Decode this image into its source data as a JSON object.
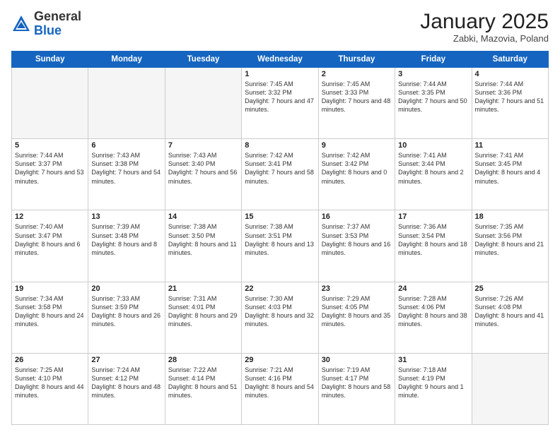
{
  "logo": {
    "general": "General",
    "blue": "Blue"
  },
  "header": {
    "month": "January 2025",
    "location": "Zabki, Mazovia, Poland"
  },
  "days": [
    "Sunday",
    "Monday",
    "Tuesday",
    "Wednesday",
    "Thursday",
    "Friday",
    "Saturday"
  ],
  "weeks": [
    [
      {
        "day": "",
        "content": ""
      },
      {
        "day": "",
        "content": ""
      },
      {
        "day": "",
        "content": ""
      },
      {
        "day": "1",
        "content": "Sunrise: 7:45 AM\nSunset: 3:32 PM\nDaylight: 7 hours and 47 minutes."
      },
      {
        "day": "2",
        "content": "Sunrise: 7:45 AM\nSunset: 3:33 PM\nDaylight: 7 hours and 48 minutes."
      },
      {
        "day": "3",
        "content": "Sunrise: 7:44 AM\nSunset: 3:35 PM\nDaylight: 7 hours and 50 minutes."
      },
      {
        "day": "4",
        "content": "Sunrise: 7:44 AM\nSunset: 3:36 PM\nDaylight: 7 hours and 51 minutes."
      }
    ],
    [
      {
        "day": "5",
        "content": "Sunrise: 7:44 AM\nSunset: 3:37 PM\nDaylight: 7 hours and 53 minutes."
      },
      {
        "day": "6",
        "content": "Sunrise: 7:43 AM\nSunset: 3:38 PM\nDaylight: 7 hours and 54 minutes."
      },
      {
        "day": "7",
        "content": "Sunrise: 7:43 AM\nSunset: 3:40 PM\nDaylight: 7 hours and 56 minutes."
      },
      {
        "day": "8",
        "content": "Sunrise: 7:42 AM\nSunset: 3:41 PM\nDaylight: 7 hours and 58 minutes."
      },
      {
        "day": "9",
        "content": "Sunrise: 7:42 AM\nSunset: 3:42 PM\nDaylight: 8 hours and 0 minutes."
      },
      {
        "day": "10",
        "content": "Sunrise: 7:41 AM\nSunset: 3:44 PM\nDaylight: 8 hours and 2 minutes."
      },
      {
        "day": "11",
        "content": "Sunrise: 7:41 AM\nSunset: 3:45 PM\nDaylight: 8 hours and 4 minutes."
      }
    ],
    [
      {
        "day": "12",
        "content": "Sunrise: 7:40 AM\nSunset: 3:47 PM\nDaylight: 8 hours and 6 minutes."
      },
      {
        "day": "13",
        "content": "Sunrise: 7:39 AM\nSunset: 3:48 PM\nDaylight: 8 hours and 8 minutes."
      },
      {
        "day": "14",
        "content": "Sunrise: 7:38 AM\nSunset: 3:50 PM\nDaylight: 8 hours and 11 minutes."
      },
      {
        "day": "15",
        "content": "Sunrise: 7:38 AM\nSunset: 3:51 PM\nDaylight: 8 hours and 13 minutes."
      },
      {
        "day": "16",
        "content": "Sunrise: 7:37 AM\nSunset: 3:53 PM\nDaylight: 8 hours and 16 minutes."
      },
      {
        "day": "17",
        "content": "Sunrise: 7:36 AM\nSunset: 3:54 PM\nDaylight: 8 hours and 18 minutes."
      },
      {
        "day": "18",
        "content": "Sunrise: 7:35 AM\nSunset: 3:56 PM\nDaylight: 8 hours and 21 minutes."
      }
    ],
    [
      {
        "day": "19",
        "content": "Sunrise: 7:34 AM\nSunset: 3:58 PM\nDaylight: 8 hours and 24 minutes."
      },
      {
        "day": "20",
        "content": "Sunrise: 7:33 AM\nSunset: 3:59 PM\nDaylight: 8 hours and 26 minutes."
      },
      {
        "day": "21",
        "content": "Sunrise: 7:31 AM\nSunset: 4:01 PM\nDaylight: 8 hours and 29 minutes."
      },
      {
        "day": "22",
        "content": "Sunrise: 7:30 AM\nSunset: 4:03 PM\nDaylight: 8 hours and 32 minutes."
      },
      {
        "day": "23",
        "content": "Sunrise: 7:29 AM\nSunset: 4:05 PM\nDaylight: 8 hours and 35 minutes."
      },
      {
        "day": "24",
        "content": "Sunrise: 7:28 AM\nSunset: 4:06 PM\nDaylight: 8 hours and 38 minutes."
      },
      {
        "day": "25",
        "content": "Sunrise: 7:26 AM\nSunset: 4:08 PM\nDaylight: 8 hours and 41 minutes."
      }
    ],
    [
      {
        "day": "26",
        "content": "Sunrise: 7:25 AM\nSunset: 4:10 PM\nDaylight: 8 hours and 44 minutes."
      },
      {
        "day": "27",
        "content": "Sunrise: 7:24 AM\nSunset: 4:12 PM\nDaylight: 8 hours and 48 minutes."
      },
      {
        "day": "28",
        "content": "Sunrise: 7:22 AM\nSunset: 4:14 PM\nDaylight: 8 hours and 51 minutes."
      },
      {
        "day": "29",
        "content": "Sunrise: 7:21 AM\nSunset: 4:16 PM\nDaylight: 8 hours and 54 minutes."
      },
      {
        "day": "30",
        "content": "Sunrise: 7:19 AM\nSunset: 4:17 PM\nDaylight: 8 hours and 58 minutes."
      },
      {
        "day": "31",
        "content": "Sunrise: 7:18 AM\nSunset: 4:19 PM\nDaylight: 9 hours and 1 minute."
      },
      {
        "day": "",
        "content": ""
      }
    ]
  ]
}
